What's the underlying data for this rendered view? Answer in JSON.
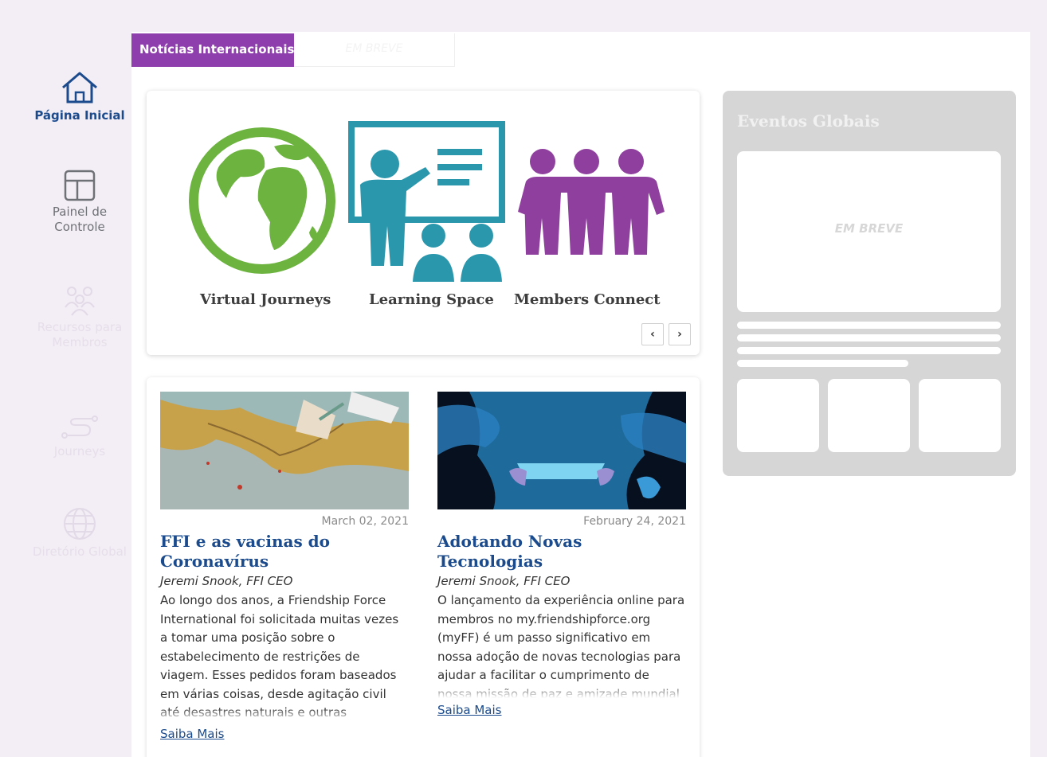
{
  "sidebar": {
    "items": [
      {
        "label": "Página Inicial",
        "icon": "home-icon",
        "state": "active"
      },
      {
        "label": "Painel de Controle",
        "icon": "dashboard-icon",
        "state": "enabled"
      },
      {
        "label": "Recursos para Membros",
        "icon": "members-icon",
        "state": "disabled"
      },
      {
        "label": "Journeys",
        "icon": "route-icon",
        "state": "disabled"
      },
      {
        "label": "Diretório Global",
        "icon": "globe-icon",
        "state": "disabled"
      }
    ]
  },
  "tabs": {
    "active": "Notícias Internacionais",
    "soon": "EM BREVE"
  },
  "carousel": {
    "labels": [
      "Virtual Journeys",
      "Learning Space",
      "Members Connect"
    ],
    "prev": "‹",
    "next": "›"
  },
  "news": [
    {
      "date": "March 02, 2021",
      "title": "FFI e as vacinas do Coronavírus",
      "author": "Jeremi Snook, FFI CEO",
      "excerpt": "Ao longo dos anos, a Friendship Force International foi solicitada muitas vezes a tomar uma posição sobre o estabelecimento de restrições de viagem. Esses pedidos foram baseados em várias coisas, desde agitação civil até desastres naturais e outras",
      "more": "Saiba Mais"
    },
    {
      "date": "February 24, 2021",
      "title": "Adotando Novas Tecnologias",
      "author": "Jeremi Snook, FFI CEO",
      "excerpt": "O lançamento da experiência online para membros no my.friendshipforce.org (myFF) é um passo significativo em nossa adoção de novas tecnologias para ajudar a facilitar o cumprimento de nossa missão de paz e amizade mundial",
      "more": "Saiba Mais"
    }
  ],
  "events": {
    "title": "Eventos Globais",
    "placeholder": "EM BREVE"
  },
  "colors": {
    "accent_purple": "#8e3fad",
    "globe_green": "#6cb33f",
    "teal": "#2a97ad",
    "members_purple": "#8f3f9e",
    "link_blue": "#1b4b8c",
    "background": "#f3edf6"
  }
}
